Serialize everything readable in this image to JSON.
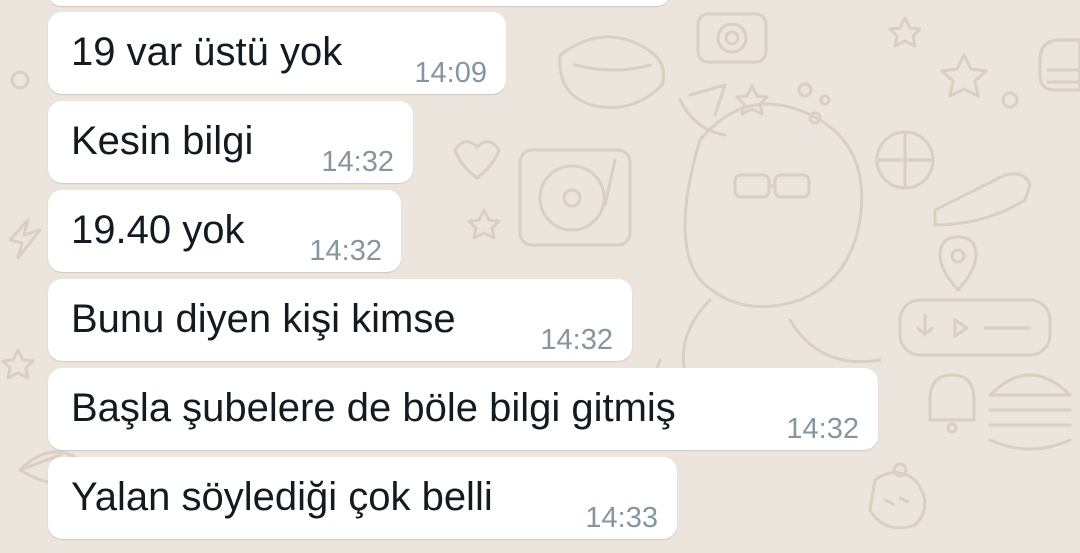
{
  "theme": {
    "wallpaper_color": "#ece5dd",
    "doodle_color": "#d9cfc3",
    "bubble_color": "#ffffff",
    "text_color": "#111b21",
    "time_color": "#8696a0"
  },
  "messages": [
    {
      "text": "19 var üstü yok",
      "time": "14:09"
    },
    {
      "text": "Kesin bilgi",
      "time": "14:32"
    },
    {
      "text": "19.40 yok",
      "time": "14:32"
    },
    {
      "text": "Bunu diyen kişi kimse",
      "time": "14:32"
    },
    {
      "text": "Başla şubelere de böle bilgi gitmiş",
      "time": "14:32"
    },
    {
      "text": "Yalan söylediği çok belli",
      "time": "14:33"
    }
  ]
}
